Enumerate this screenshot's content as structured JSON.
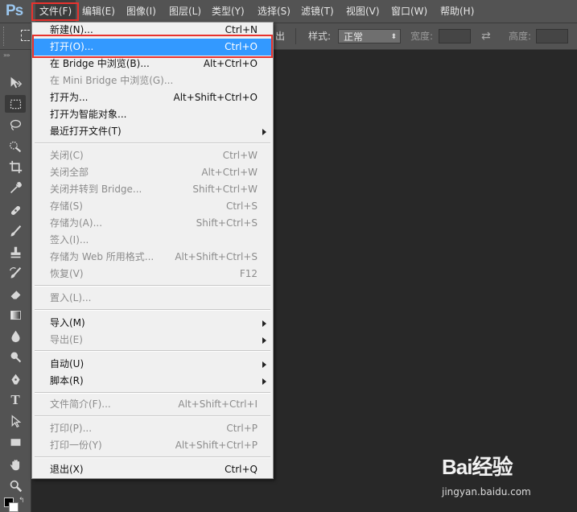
{
  "app": {
    "logo": "Ps"
  },
  "menubar": {
    "items": [
      {
        "label": "文件(F)"
      },
      {
        "label": "编辑(E)"
      },
      {
        "label": "图像(I)"
      },
      {
        "label": "图层(L)"
      },
      {
        "label": "类型(Y)"
      },
      {
        "label": "选择(S)"
      },
      {
        "label": "滤镜(T)"
      },
      {
        "label": "视图(V)"
      },
      {
        "label": "窗口(W)"
      },
      {
        "label": "帮助(H)"
      }
    ]
  },
  "options": {
    "partial_label": "出",
    "style_label": "样式:",
    "style_value": "正常",
    "width_label": "宽度:",
    "height_label": "高度:"
  },
  "toolbar": {
    "tools": [
      "move-tool",
      "marquee-tool",
      "lasso-tool",
      "quick-selection-tool",
      "crop-tool",
      "eyedropper-tool",
      "healing-brush-tool",
      "brush-tool",
      "clone-stamp-tool",
      "history-brush-tool",
      "eraser-tool",
      "gradient-tool",
      "blur-tool",
      "dodge-tool",
      "pen-tool",
      "type-tool",
      "path-selection-tool",
      "shape-tool",
      "hand-tool",
      "zoom-tool"
    ]
  },
  "file_menu": {
    "items": [
      {
        "label": "新建(N)...",
        "shortcut": "Ctrl+N"
      },
      {
        "label": "打开(O)...",
        "shortcut": "Ctrl+O"
      },
      {
        "label": "在 Bridge 中浏览(B)...",
        "shortcut": "Alt+Ctrl+O"
      },
      {
        "label": "在 Mini Bridge 中浏览(G)...",
        "shortcut": ""
      },
      {
        "label": "打开为...",
        "shortcut": "Alt+Shift+Ctrl+O"
      },
      {
        "label": "打开为智能对象...",
        "shortcut": ""
      },
      {
        "label": "最近打开文件(T)",
        "shortcut": ""
      },
      {
        "label": "关闭(C)",
        "shortcut": "Ctrl+W"
      },
      {
        "label": "关闭全部",
        "shortcut": "Alt+Ctrl+W"
      },
      {
        "label": "关闭并转到 Bridge...",
        "shortcut": "Shift+Ctrl+W"
      },
      {
        "label": "存储(S)",
        "shortcut": "Ctrl+S"
      },
      {
        "label": "存储为(A)...",
        "shortcut": "Shift+Ctrl+S"
      },
      {
        "label": "签入(I)...",
        "shortcut": ""
      },
      {
        "label": "存储为 Web 所用格式...",
        "shortcut": "Alt+Shift+Ctrl+S"
      },
      {
        "label": "恢复(V)",
        "shortcut": "F12"
      },
      {
        "label": "置入(L)...",
        "shortcut": ""
      },
      {
        "label": "导入(M)",
        "shortcut": ""
      },
      {
        "label": "导出(E)",
        "shortcut": ""
      },
      {
        "label": "自动(U)",
        "shortcut": ""
      },
      {
        "label": "脚本(R)",
        "shortcut": ""
      },
      {
        "label": "文件简介(F)...",
        "shortcut": "Alt+Shift+Ctrl+I"
      },
      {
        "label": "打印(P)...",
        "shortcut": "Ctrl+P"
      },
      {
        "label": "打印一份(Y)",
        "shortcut": "Alt+Shift+Ctrl+P"
      },
      {
        "label": "退出(X)",
        "shortcut": "Ctrl+Q"
      }
    ]
  },
  "watermark": {
    "main": "Bai经验",
    "sub": "jingyan.baidu.com"
  },
  "colors": {
    "highlight": "#3399ff",
    "annotation": "#e8322e"
  }
}
